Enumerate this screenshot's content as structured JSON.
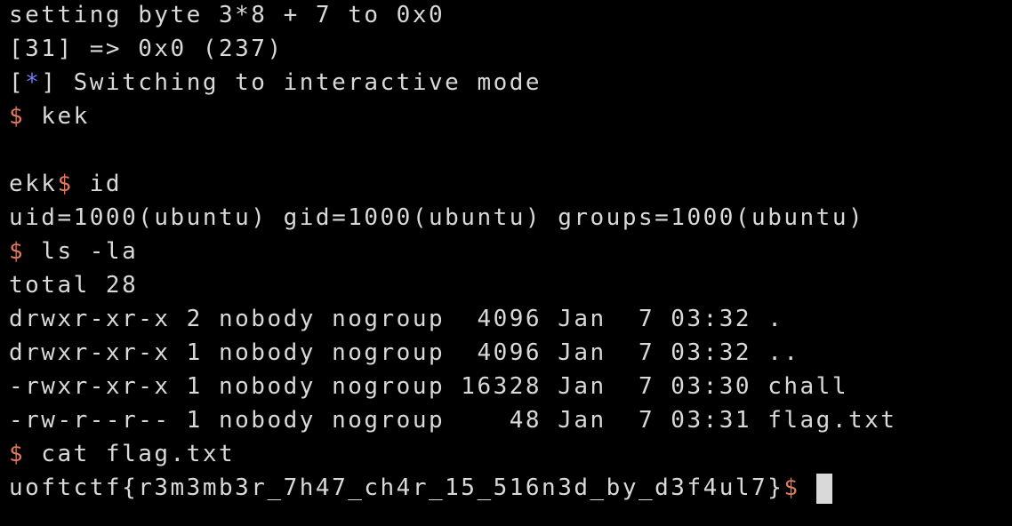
{
  "terminal": {
    "lines": {
      "l0": "setting byte 3*8 + 7 to 0x0",
      "l1": "[31] => 0x0 (237)",
      "l2_open": "[",
      "l2_star": "*",
      "l2_rest": "] Switching to interactive mode",
      "l3_prompt": "$",
      "l3_cmd": " kek",
      "l5_user": "ekk",
      "l5_prompt": "$",
      "l5_cmd": " id",
      "l6": "uid=1000(ubuntu) gid=1000(ubuntu) groups=1000(ubuntu)",
      "l7_prompt": "$",
      "l7_cmd": " ls -la",
      "l8": "total 28",
      "l9": "drwxr-xr-x 2 nobody nogroup  4096 Jan  7 03:32 .",
      "l10": "drwxr-xr-x 1 nobody nogroup  4096 Jan  7 03:32 ..",
      "l11": "-rwxr-xr-x 1 nobody nogroup 16328 Jan  7 03:30 chall",
      "l12": "-rw-r--r-- 1 nobody nogroup    48 Jan  7 03:31 flag.txt",
      "l13_prompt": "$",
      "l13_cmd": " cat flag.txt",
      "l14_flag": "uoftctf{r3m3mb3r_7h47_ch4r_15_516n3d_by_d3f4ul7}",
      "l14_prompt": "$",
      "l14_space": " "
    },
    "colors": {
      "background": "#000000",
      "text": "#d9d9d9",
      "prompt": "#e07a5f",
      "info_star": "#6f7dff",
      "cursor": "#d9d9d9"
    }
  }
}
